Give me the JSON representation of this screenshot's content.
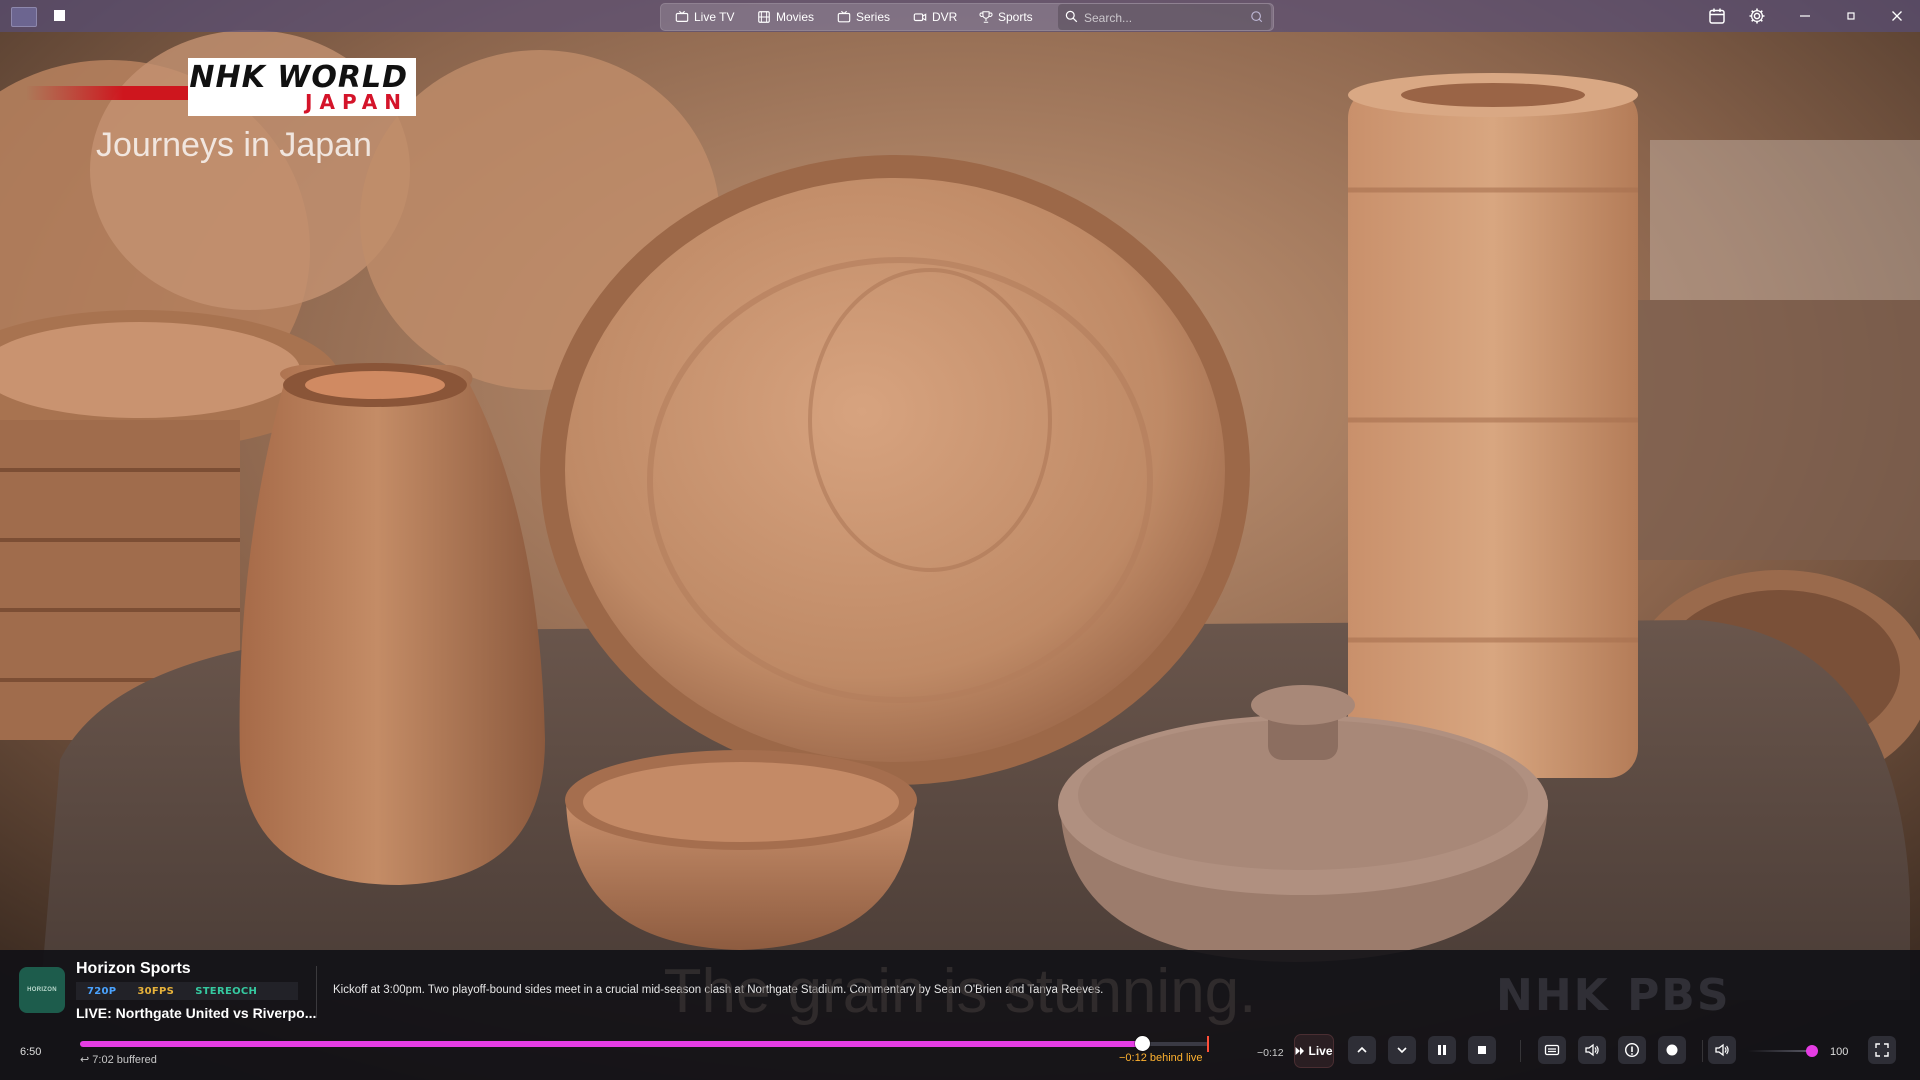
{
  "colors": {
    "accent": "#e53de4",
    "live_edge": "#ff4f3a",
    "behind_live": "#ffb22f",
    "topbar": "#584e76"
  },
  "video": {
    "overlay_logo": {
      "line1": "NHK WORLD",
      "line2": "JAPAN"
    },
    "show_title": "Journeys in Japan",
    "subtitle": "The grain is stunning.",
    "watermark": "NHK PBS"
  },
  "topbar": {
    "nav": [
      {
        "label": "Live TV",
        "icon": "tv-icon"
      },
      {
        "label": "Movies",
        "icon": "film-icon"
      },
      {
        "label": "Series",
        "icon": "series-icon"
      },
      {
        "label": "DVR",
        "icon": "camera-icon"
      },
      {
        "label": "Sports",
        "icon": "trophy-icon"
      }
    ],
    "search_placeholder": "Search...",
    "right_icons": [
      "calendar-icon",
      "gear-icon"
    ],
    "window_controls": [
      "minimize-icon",
      "maximize-icon",
      "close-icon"
    ]
  },
  "player": {
    "channel": {
      "logo_text": "HORIZON",
      "name": "Horizon Sports",
      "badges": [
        {
          "label": "720P",
          "color": "#4aa3ff"
        },
        {
          "label": "30FPS",
          "color": "#e7b23a"
        },
        {
          "label": "STEREOCH",
          "color": "#35c9a0"
        }
      ],
      "program": "LIVE: Northgate United vs Riverpo..."
    },
    "description": "Kickoff at 3:00pm. Two playoff-bound sides meet in a crucial mid-season clash at Northgate Stadium. Commentary by Sean O'Brien and Tanya Reeves.",
    "time_current": "6:50",
    "progress_fraction": 0.9415,
    "buffered": "7:02 buffered",
    "behind_live": "−0:12 behind live",
    "offset": "−0:12",
    "live_label": "Live",
    "volume": {
      "value": 100,
      "display": "100"
    },
    "controls": [
      "chevron-up-icon",
      "chevron-down-icon",
      "pause-icon",
      "stop-icon",
      "subtitles-icon",
      "audio-track-icon",
      "info-icon",
      "record-icon",
      "volume-icon",
      "fullscreen-icon"
    ]
  }
}
